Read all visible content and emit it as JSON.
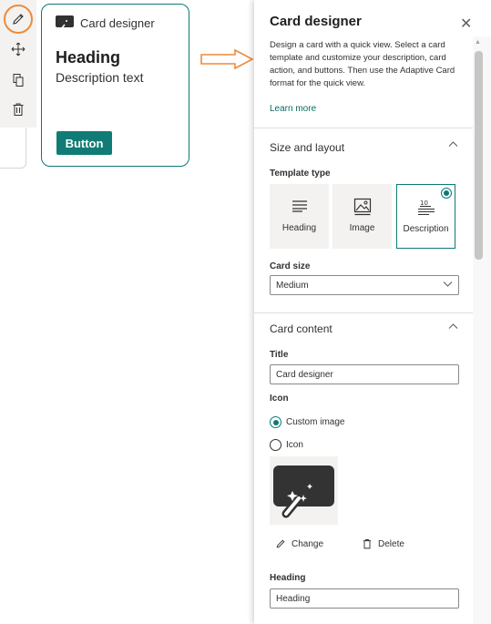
{
  "card_preview": {
    "title": "Card designer",
    "heading": "Heading",
    "description": "Description text",
    "button_label": "Button"
  },
  "colors": {
    "accent": "#107c75",
    "highlight": "#ee8a3a"
  },
  "toolbar": {
    "icons": [
      "pencil-icon",
      "move-icon",
      "copy-icon",
      "trash-icon"
    ]
  },
  "panel": {
    "title": "Card designer",
    "intro": "Design a card with a quick view. Select a card template and customize your description, card action, and buttons. Then use the Adaptive Card format for the quick view.",
    "learn_more": "Learn more",
    "size_layout": {
      "title": "Size and layout",
      "template_type_label": "Template type",
      "templates": [
        {
          "label": "Heading",
          "selected": false
        },
        {
          "label": "Image",
          "selected": false
        },
        {
          "label": "Description",
          "selected": true
        }
      ],
      "card_size_label": "Card size",
      "card_size_value": "Medium"
    },
    "card_content": {
      "title": "Card content",
      "title_label": "Title",
      "title_value": "Card designer",
      "icon_label": "Icon",
      "radio_options": [
        {
          "label": "Custom image",
          "selected": true
        },
        {
          "label": "Icon",
          "selected": false
        }
      ],
      "change_label": "Change",
      "delete_label": "Delete",
      "heading_label": "Heading",
      "heading_value": "Heading"
    }
  }
}
